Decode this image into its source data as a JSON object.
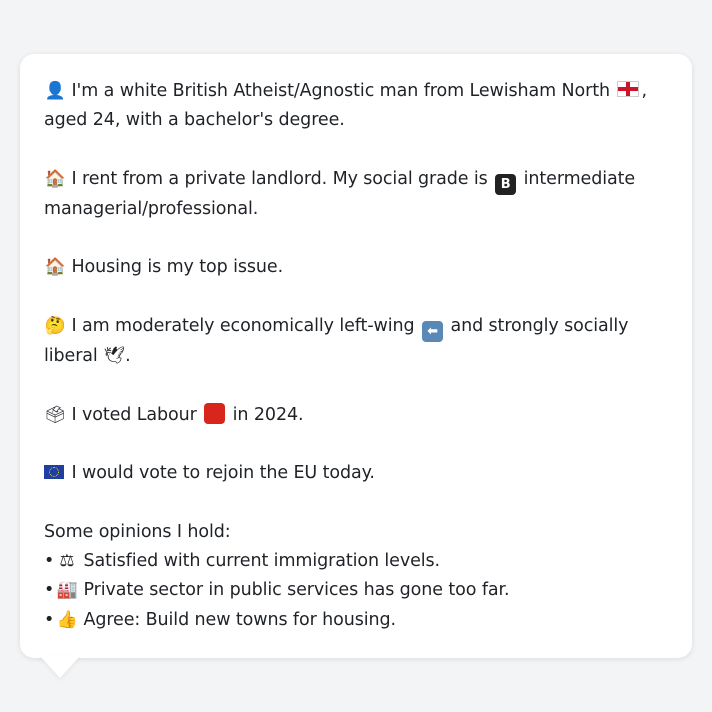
{
  "message": {
    "p1": {
      "icon": "bust-in-silhouette-icon",
      "before_flag": "I'm a white British Atheist/Agnostic man from Lewisham North",
      "flag": "england-flag-icon",
      "after_flag": ", aged 24, with a bachelor's degree."
    },
    "p2": {
      "icon": "house-icon",
      "before_badge": "I rent from a private landlord. My social grade is",
      "badge_letter": "B",
      "after_badge": "intermediate managerial/professional."
    },
    "p3": {
      "icon": "house-icon",
      "text": "Housing is my top issue."
    },
    "p4": {
      "icon": "thinking-face-icon",
      "before_arrow": "I am moderately economically left-wing",
      "arrow": "left-arrow-icon",
      "middle": "and strongly socially liberal",
      "dove": "dove-icon",
      "end": "."
    },
    "p5": {
      "icon": "ballot-box-icon",
      "before_square": "I voted Labour",
      "square": "red-square-icon",
      "after_square": "in 2024."
    },
    "p6": {
      "icon": "eu-flag-icon",
      "text": "I would vote to rejoin the EU today."
    },
    "opinions": {
      "heading": "Some opinions I hold:",
      "items": [
        {
          "icon": "balance-scale-icon",
          "text": "Satisfied with current immigration levels."
        },
        {
          "icon": "factory-icon",
          "text": "Private sector in public services has gone too far."
        },
        {
          "icon": "thumbs-up-icon",
          "text": "Agree: Build new towns for housing."
        }
      ]
    }
  },
  "colors": {
    "background": "#f3f4f6",
    "bubble": "#ffffff",
    "text": "#1f2328",
    "labour_red": "#d9261c",
    "eu_blue": "#1f3fa3"
  }
}
